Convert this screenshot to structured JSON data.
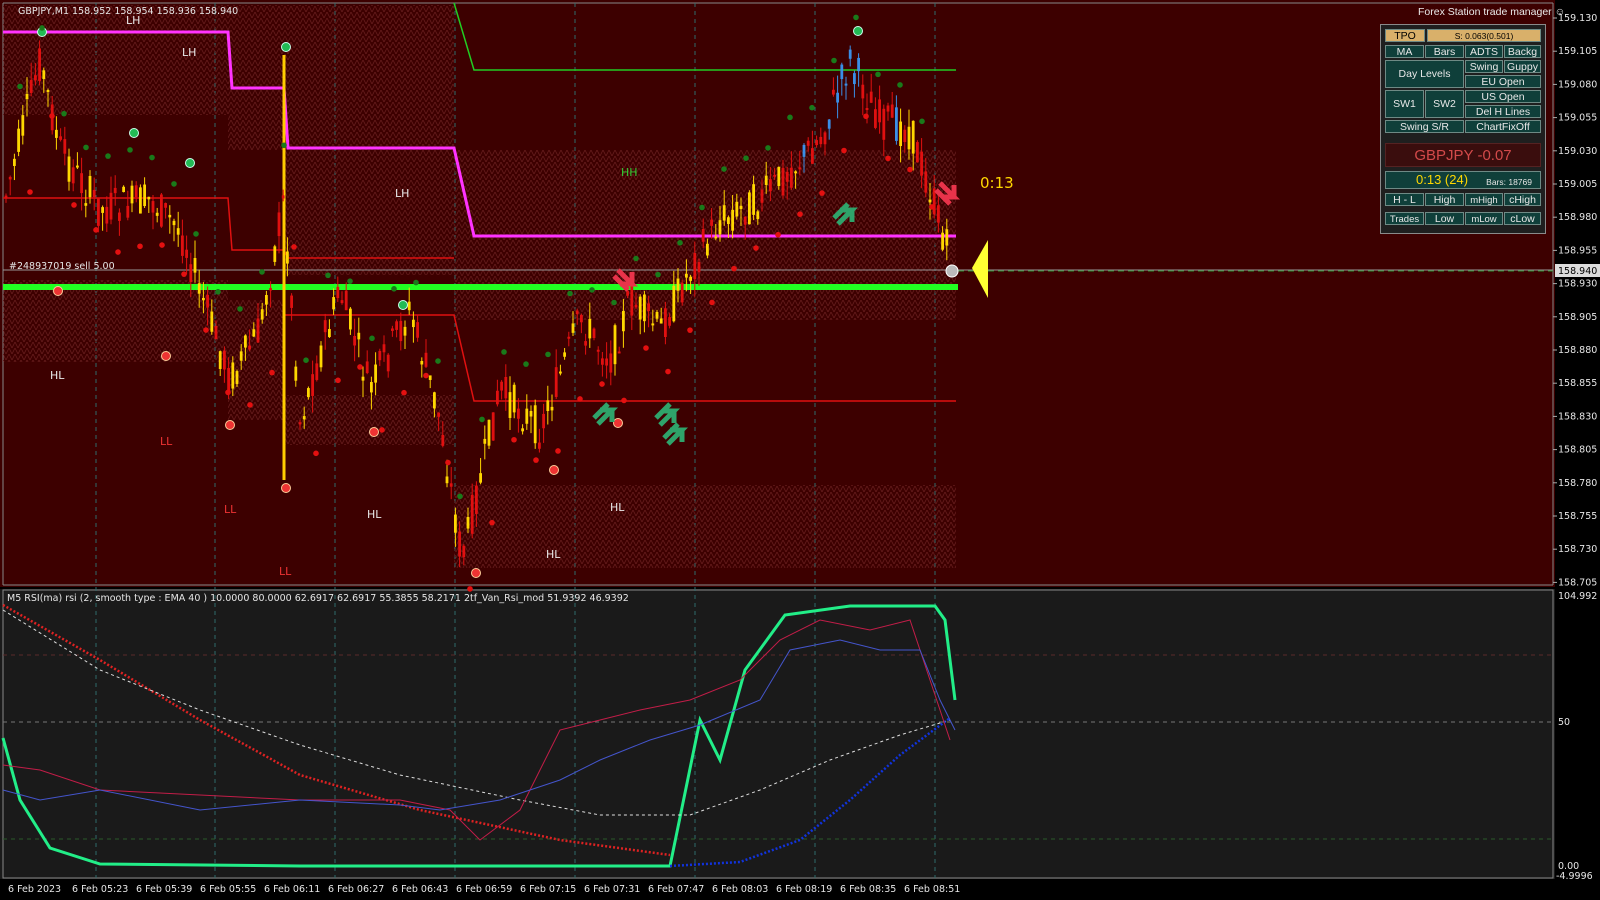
{
  "header": {
    "symbol_info": "GBPJPY,M1  158.952 158.954 158.936 158.940",
    "trade_manager_title": "Forex Station trade manager ☺",
    "order_label": "#248937019 sell 5.00",
    "countdown": "0:13"
  },
  "price_axis": {
    "ticks": [
      "159.130",
      "159.105",
      "159.080",
      "159.055",
      "159.030",
      "159.005",
      "158.980",
      "158.955",
      "158.930",
      "158.905",
      "158.880",
      "158.855",
      "158.830",
      "158.805",
      "158.780",
      "158.755",
      "158.730",
      "158.705"
    ],
    "current_price": "158.940"
  },
  "time_axis": {
    "ticks": [
      "6 Feb 2023",
      "6 Feb 05:23",
      "6 Feb 05:39",
      "6 Feb 05:55",
      "6 Feb 06:11",
      "6 Feb 06:27",
      "6 Feb 06:43",
      "6 Feb 06:59",
      "6 Feb 07:15",
      "6 Feb 07:31",
      "6 Feb 07:47",
      "6 Feb 08:03",
      "6 Feb 08:19",
      "6 Feb 08:35",
      "6 Feb 08:51"
    ]
  },
  "structure_labels": [
    "LH",
    "LH",
    "LH",
    "HH",
    "HL",
    "LL",
    "LL",
    "HL",
    "LL",
    "HL",
    "HL"
  ],
  "indicator": {
    "title": "M5 RSI(ma) rsi (2, smooth type : EMA  40 ) 10.0000 80.0000 62.6917 62.6917 55.3855 58.2171  2tf_Van_Rsi_mod 51.9392 46.9392",
    "ticks": [
      "104.992",
      "50",
      "0.00",
      "-4.9996"
    ]
  },
  "trade_manager": {
    "buttons": {
      "tpo": "TPO",
      "spread": "S: 0.063(0.501)",
      "ma": "MA",
      "bars": "Bars",
      "adts": "ADTS",
      "backg": "Backg",
      "day_levels": "Day Levels",
      "swing": "Swing",
      "guppy": "Guppy",
      "eu_open": "EU Open",
      "sw1": "SW1",
      "sw2": "SW2",
      "us_open": "US Open",
      "del_h_lines": "Del H Lines",
      "swing_sr": "Swing S/R",
      "chart_fix_off": "ChartFixOff",
      "h_l": "H - L",
      "high": "High",
      "m_high": "mHigh",
      "c_high": "cHigh",
      "trades": "Trades",
      "low": "Low",
      "m_low": "mLow",
      "c_low": "cLow"
    },
    "symbol_change": "GBPJPY -0.07",
    "timer": "0:13 (24)",
    "bars_count": "Bars: 18769"
  },
  "colors": {
    "background": "#3d0000",
    "indicator_background": "#1a1a1a",
    "bull_candle": "#ffd700",
    "bear_candle": "#e01010",
    "blue_candle": "#3a8ee6",
    "pivot_line": "#22ff22",
    "magenta_line": "#ff33ff",
    "rsi_fast": "#22ee88",
    "rsi_slow": "#dd1144"
  },
  "chart_data": {
    "type": "candlestick",
    "symbol": "GBPJPY",
    "timeframe": "M1",
    "ylim": [
      158.698,
      159.138
    ],
    "current_price": 158.94,
    "levels": [
      {
        "kind": "pivot",
        "value": 158.924
      },
      {
        "kind": "magenta",
        "segments": [
          [
            0,
            159.118
          ],
          [
            0.24,
            159.078
          ],
          [
            0.29,
            159.05
          ],
          [
            0.5,
            158.97
          ]
        ]
      },
      {
        "kind": "red",
        "segments": [
          [
            0.06,
            158.992
          ],
          [
            0.24,
            158.95
          ],
          [
            0.29,
            158.908
          ],
          [
            0.5,
            158.842
          ]
        ]
      },
      {
        "kind": "green",
        "segments": [
          [
            0.47,
            159.138
          ],
          [
            0.5,
            159.09
          ]
        ]
      }
    ],
    "rsi": {
      "ylim": [
        -4.9996,
        104.992
      ],
      "levels": [
        50,
        80,
        10
      ]
    }
  }
}
